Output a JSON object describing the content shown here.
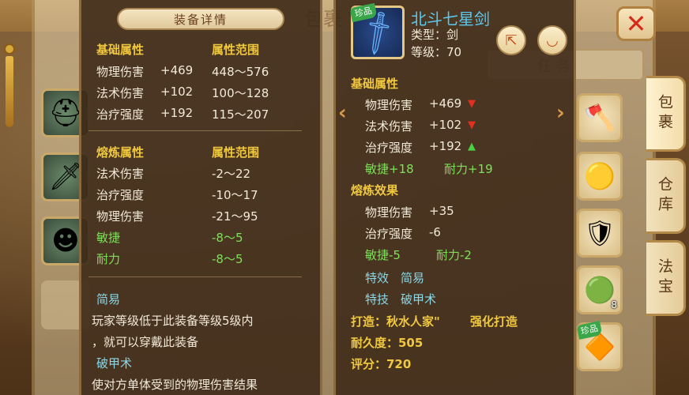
{
  "background": {
    "bag_title": "包裹",
    "tab_label": "任 务"
  },
  "close_icon": "close-icon",
  "side_tabs": [
    {
      "label": "包裹",
      "active": true
    },
    {
      "label": "仓库",
      "active": false
    },
    {
      "label": "法宝",
      "active": false
    }
  ],
  "left_slots": [
    {
      "icon": "helmet-icon",
      "glyph": "⛑"
    },
    {
      "icon": "sword-icon",
      "glyph": "🗡"
    },
    {
      "icon": "mask-icon",
      "glyph": "☻"
    }
  ],
  "right_slots": [
    {
      "icon": "axe-icon",
      "glyph": "🪓",
      "count": "",
      "rare": ""
    },
    {
      "icon": "orb-icon",
      "glyph": "🟡",
      "count": "",
      "rare": ""
    },
    {
      "icon": "armor-icon",
      "glyph": "🛡",
      "count": "",
      "rare": ""
    },
    {
      "icon": "jade-icon",
      "glyph": "🟢",
      "count": "8",
      "rare": ""
    },
    {
      "icon": "crystal-icon",
      "glyph": "🔶",
      "count": "",
      "rare": "珍品"
    }
  ],
  "compare_panel": {
    "title": "装备详情",
    "base_header": "基础属性",
    "range_header": "属性范围",
    "base_rows": [
      {
        "name": "物理伤害",
        "value": "+469",
        "range": "448～576"
      },
      {
        "name": "法术伤害",
        "value": "+102",
        "range": "100～128"
      },
      {
        "name": "治疗强度",
        "value": "+192",
        "range": "115～207"
      }
    ],
    "refine_header": "熔炼属性",
    "refine_range_header": "属性范围",
    "refine_rows": [
      {
        "name": "法术伤害",
        "range": "-2～22",
        "color": "white"
      },
      {
        "name": "治疗强度",
        "range": "-10～17",
        "color": "white"
      },
      {
        "name": "物理伤害",
        "range": "-21～95",
        "color": "white"
      },
      {
        "name": "敏捷",
        "range": "-8～5",
        "color": "green"
      },
      {
        "name": "耐力",
        "range": "-8～5",
        "color": "green"
      }
    ],
    "skill1_name": "简易",
    "skill1_desc_line1": "玩家等级低于此装备等级5级内",
    "skill1_desc_line2": "，就可以穿戴此装备",
    "skill2_name": "破甲术",
    "skill2_desc_line1": "使对方单体受到的物理伤害结果"
  },
  "item_panel": {
    "rare_tag": "珍品",
    "name": "北斗七星剑",
    "type_label": "类型：剑",
    "level_label": "等级：70",
    "share_icon": "share-icon",
    "eye_icon": "eye-icon",
    "base_header": "基础属性",
    "base_rows": [
      {
        "name": "物理伤害",
        "value": "+469",
        "trend": "down"
      },
      {
        "name": "法术伤害",
        "value": "+102",
        "trend": "down"
      },
      {
        "name": "治疗强度",
        "value": "+192",
        "trend": "up"
      }
    ],
    "extra1": "敏捷+18",
    "extra2": "耐力+19",
    "refine_header": "熔炼效果",
    "refine_rows": [
      {
        "name": "物理伤害",
        "value": "+35"
      },
      {
        "name": "治疗强度",
        "value": "-6"
      }
    ],
    "refine_extra1": "敏捷-5",
    "refine_extra2": "耐力-2",
    "effect_label": "特效",
    "effect_value": "简易",
    "skill_label": "特技",
    "skill_value": "破甲术",
    "maker": "打造：秋水人家\"",
    "forge": "强化打造",
    "durability": "耐久度：505",
    "score": "评分：720"
  }
}
